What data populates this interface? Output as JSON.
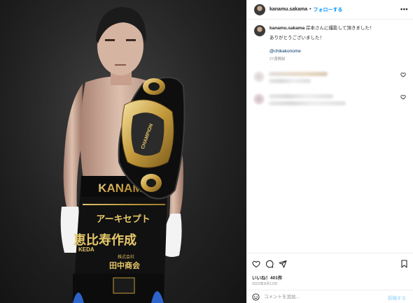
{
  "photo": {
    "trunks_name": "KANAMU",
    "trunks_sponsor_1": "アーキセプト",
    "trunks_sponsor_2": "恵比寿作成",
    "trunks_sponsor_3": "株式会社",
    "trunks_sponsor_4": "田中商会",
    "trunks_side": "KEDA",
    "belt_text": "CHAMPION"
  },
  "header": {
    "username": "kanamu.sakama",
    "separator": "•",
    "follow_label": "フォローする",
    "more_icon": "more-horizontal-icon"
  },
  "caption": {
    "username": "kanamu.sakama",
    "text": "岸本さんに撮影して頂きました！",
    "line2": "ありがとうございました！",
    "mention": "@chikakonome",
    "time": "27週間前"
  },
  "actions": {
    "likes": "いいね！401件",
    "date": "2023年8月13日"
  },
  "comment_box": {
    "placeholder": "コメントを追加...",
    "post_label": "投稿する"
  },
  "colors": {
    "accent": "#0095f6",
    "mention": "#00376b",
    "muted": "#8e8e8e"
  }
}
